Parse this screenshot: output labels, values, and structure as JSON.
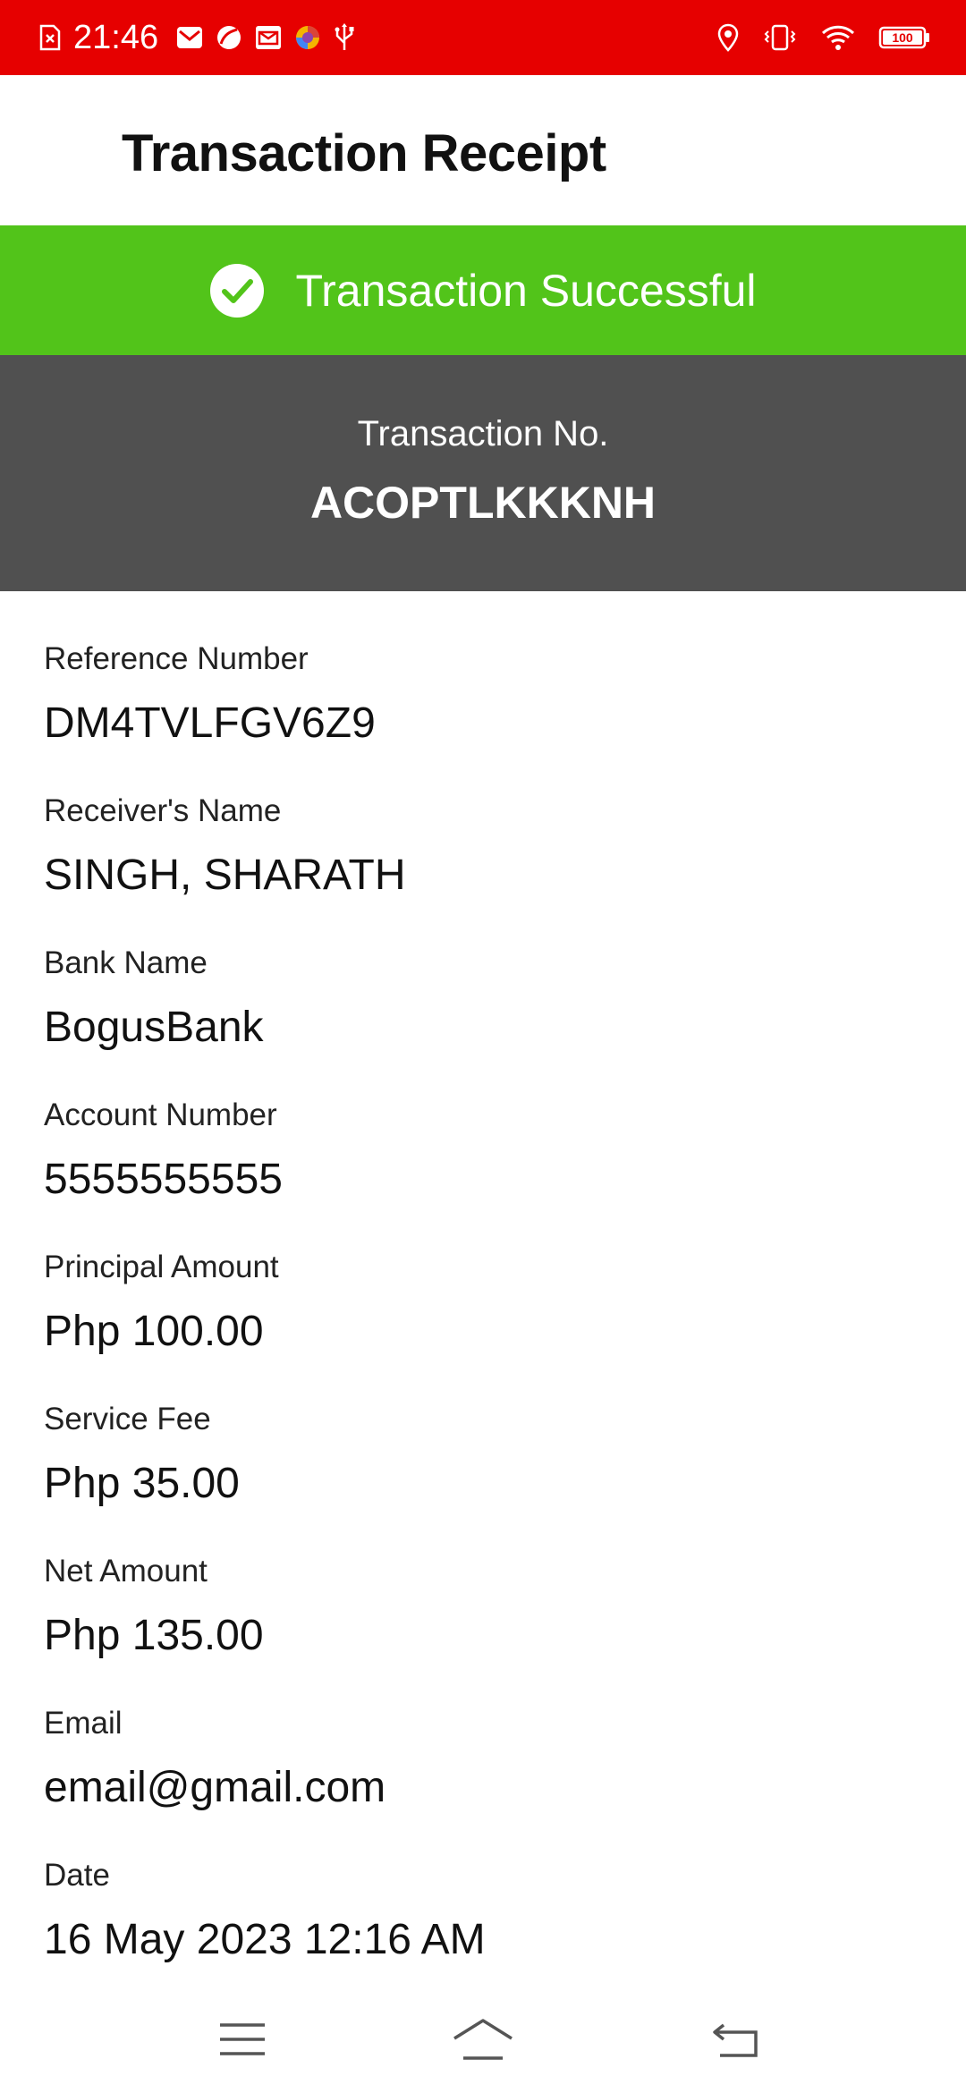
{
  "status_bar": {
    "time": "21:46",
    "battery": "100",
    "left_icons": [
      "sim-off-icon",
      "gmail-icon",
      "app-leaf-icon",
      "mail-icon",
      "browser-icon",
      "usb-icon"
    ],
    "right_icons": [
      "location-icon",
      "vibrate-icon",
      "wifi-icon",
      "battery-icon"
    ]
  },
  "header": {
    "title": "Transaction Receipt"
  },
  "banner": {
    "icon": "check-circle-icon",
    "text": "Transaction Successful",
    "color": "#52c41a"
  },
  "transaction": {
    "label": "Transaction No.",
    "number": "ACOPTLKKKNH",
    "panel_color": "#505050"
  },
  "details": [
    {
      "label": "Reference Number",
      "value": "DM4TVLFGV6Z9"
    },
    {
      "label": "Receiver's Name",
      "value": "SINGH, SHARATH"
    },
    {
      "label": "Bank Name",
      "value": "BogusBank"
    },
    {
      "label": "Account Number",
      "value": "5555555555"
    },
    {
      "label": "Principal Amount",
      "value": "Php 100.00"
    },
    {
      "label": "Service Fee",
      "value": "Php 35.00"
    },
    {
      "label": "Net Amount",
      "value": "Php 135.00"
    },
    {
      "label": "Email",
      "value": "email@gmail.com"
    },
    {
      "label": "Date",
      "value": "16 May 2023 12:16 AM"
    }
  ],
  "nav_bar": {
    "buttons": [
      "menu-icon",
      "home-icon",
      "back-icon"
    ]
  },
  "colors": {
    "status_bar": "#e60000",
    "success": "#52c41a",
    "panel": "#505050"
  }
}
